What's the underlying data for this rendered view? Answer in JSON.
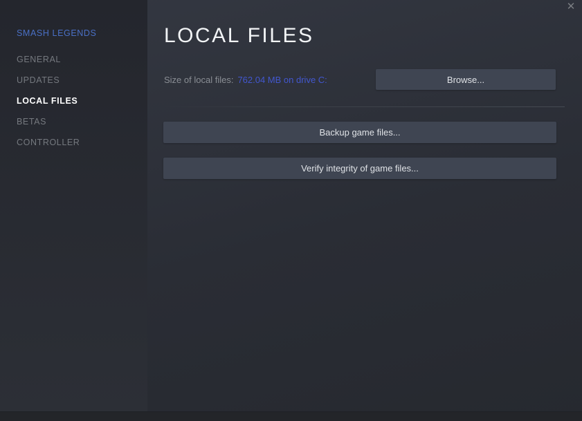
{
  "window": {
    "close_icon": "✕"
  },
  "sidebar": {
    "game_title": "SMASH LEGENDS",
    "items": [
      {
        "label": "GENERAL",
        "active": false
      },
      {
        "label": "UPDATES",
        "active": false
      },
      {
        "label": "LOCAL FILES",
        "active": true
      },
      {
        "label": "BETAS",
        "active": false
      },
      {
        "label": "CONTROLLER",
        "active": false
      }
    ]
  },
  "main": {
    "title": "LOCAL FILES",
    "size_row": {
      "label": "Size of local files:",
      "value": "762.04 MB on drive C:",
      "browse_label": "Browse..."
    },
    "actions": [
      "Backup game files...",
      "Verify integrity of game files..."
    ]
  },
  "colors": {
    "content_background_top": "#343842",
    "content_background_bottom": "#26292f",
    "sidebar_background": "#24262d",
    "button_background": "#3f4552",
    "game_title_blue": "#4a70c6",
    "link_blue": "#4257cf",
    "active_item_text": "#ffffff",
    "inactive_item_text": "#75797f"
  }
}
